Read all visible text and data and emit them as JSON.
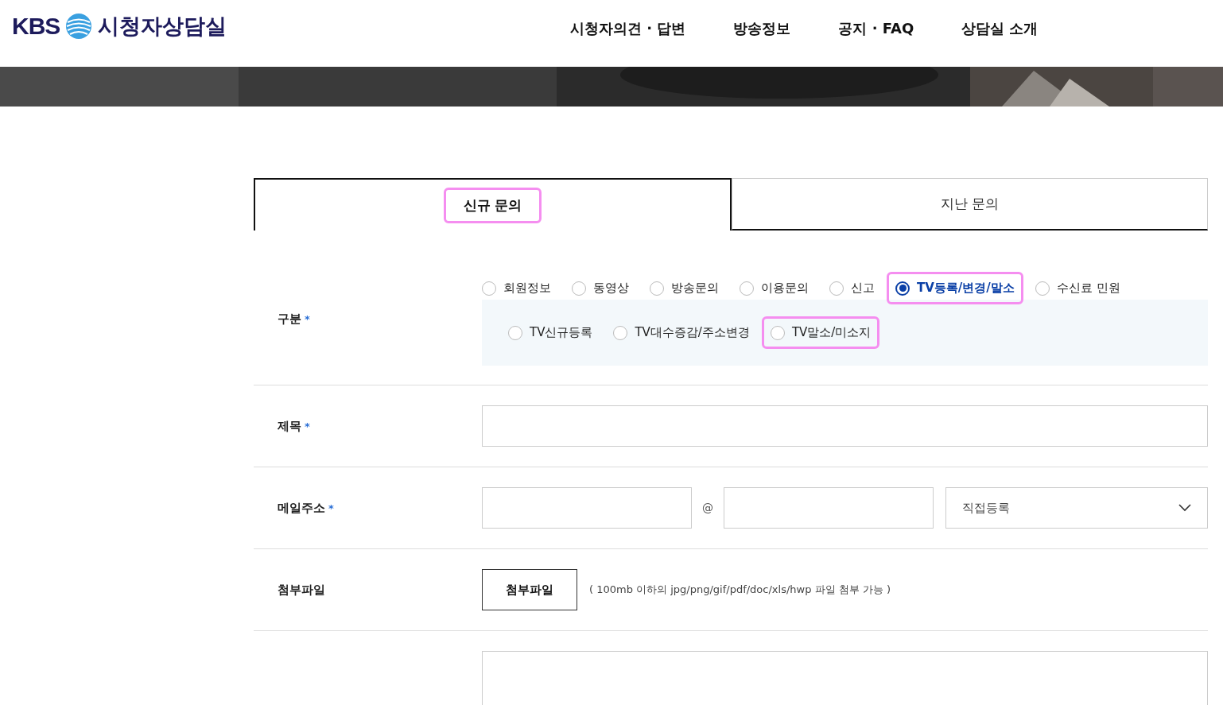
{
  "header": {
    "logo": {
      "brand": "KBS",
      "title": "시청자상담실"
    },
    "nav": [
      {
        "label": "시청자의견 · 답변"
      },
      {
        "label": "방송정보"
      },
      {
        "label": "공지 · FAQ"
      },
      {
        "label": "상담실 소개"
      }
    ]
  },
  "tabs": [
    {
      "label": "신규 문의",
      "selected": true,
      "highlighted": true
    },
    {
      "label": "지난 문의",
      "selected": false,
      "highlighted": false
    }
  ],
  "form": {
    "category": {
      "label": "구분",
      "required_mark": "*",
      "options": [
        {
          "label": "회원정보",
          "selected": false,
          "highlighted": false
        },
        {
          "label": "동영상",
          "selected": false,
          "highlighted": false
        },
        {
          "label": "방송문의",
          "selected": false,
          "highlighted": false
        },
        {
          "label": "이용문의",
          "selected": false,
          "highlighted": false
        },
        {
          "label": "신고",
          "selected": false,
          "highlighted": false
        },
        {
          "label": "TV등록/변경/말소",
          "selected": true,
          "highlighted": true
        },
        {
          "label": "수신료 민원",
          "selected": false,
          "highlighted": false
        }
      ],
      "sub_options": [
        {
          "label": "TV신규등록",
          "selected": false,
          "highlighted": false
        },
        {
          "label": "TV대수증감/주소변경",
          "selected": false,
          "highlighted": false
        },
        {
          "label": "TV말소/미소지",
          "selected": false,
          "highlighted": true
        }
      ]
    },
    "title": {
      "label": "제목",
      "required_mark": "*"
    },
    "email": {
      "label": "메일주소",
      "required_mark": "*",
      "at": "@",
      "domain_select": "직접등록"
    },
    "attachment": {
      "label": "첨부파일",
      "button": "첨부파일",
      "note": "( 100mb 이하의 jpg/png/gif/pdf/doc/xls/hwp 파일 첨부 가능 )"
    }
  }
}
